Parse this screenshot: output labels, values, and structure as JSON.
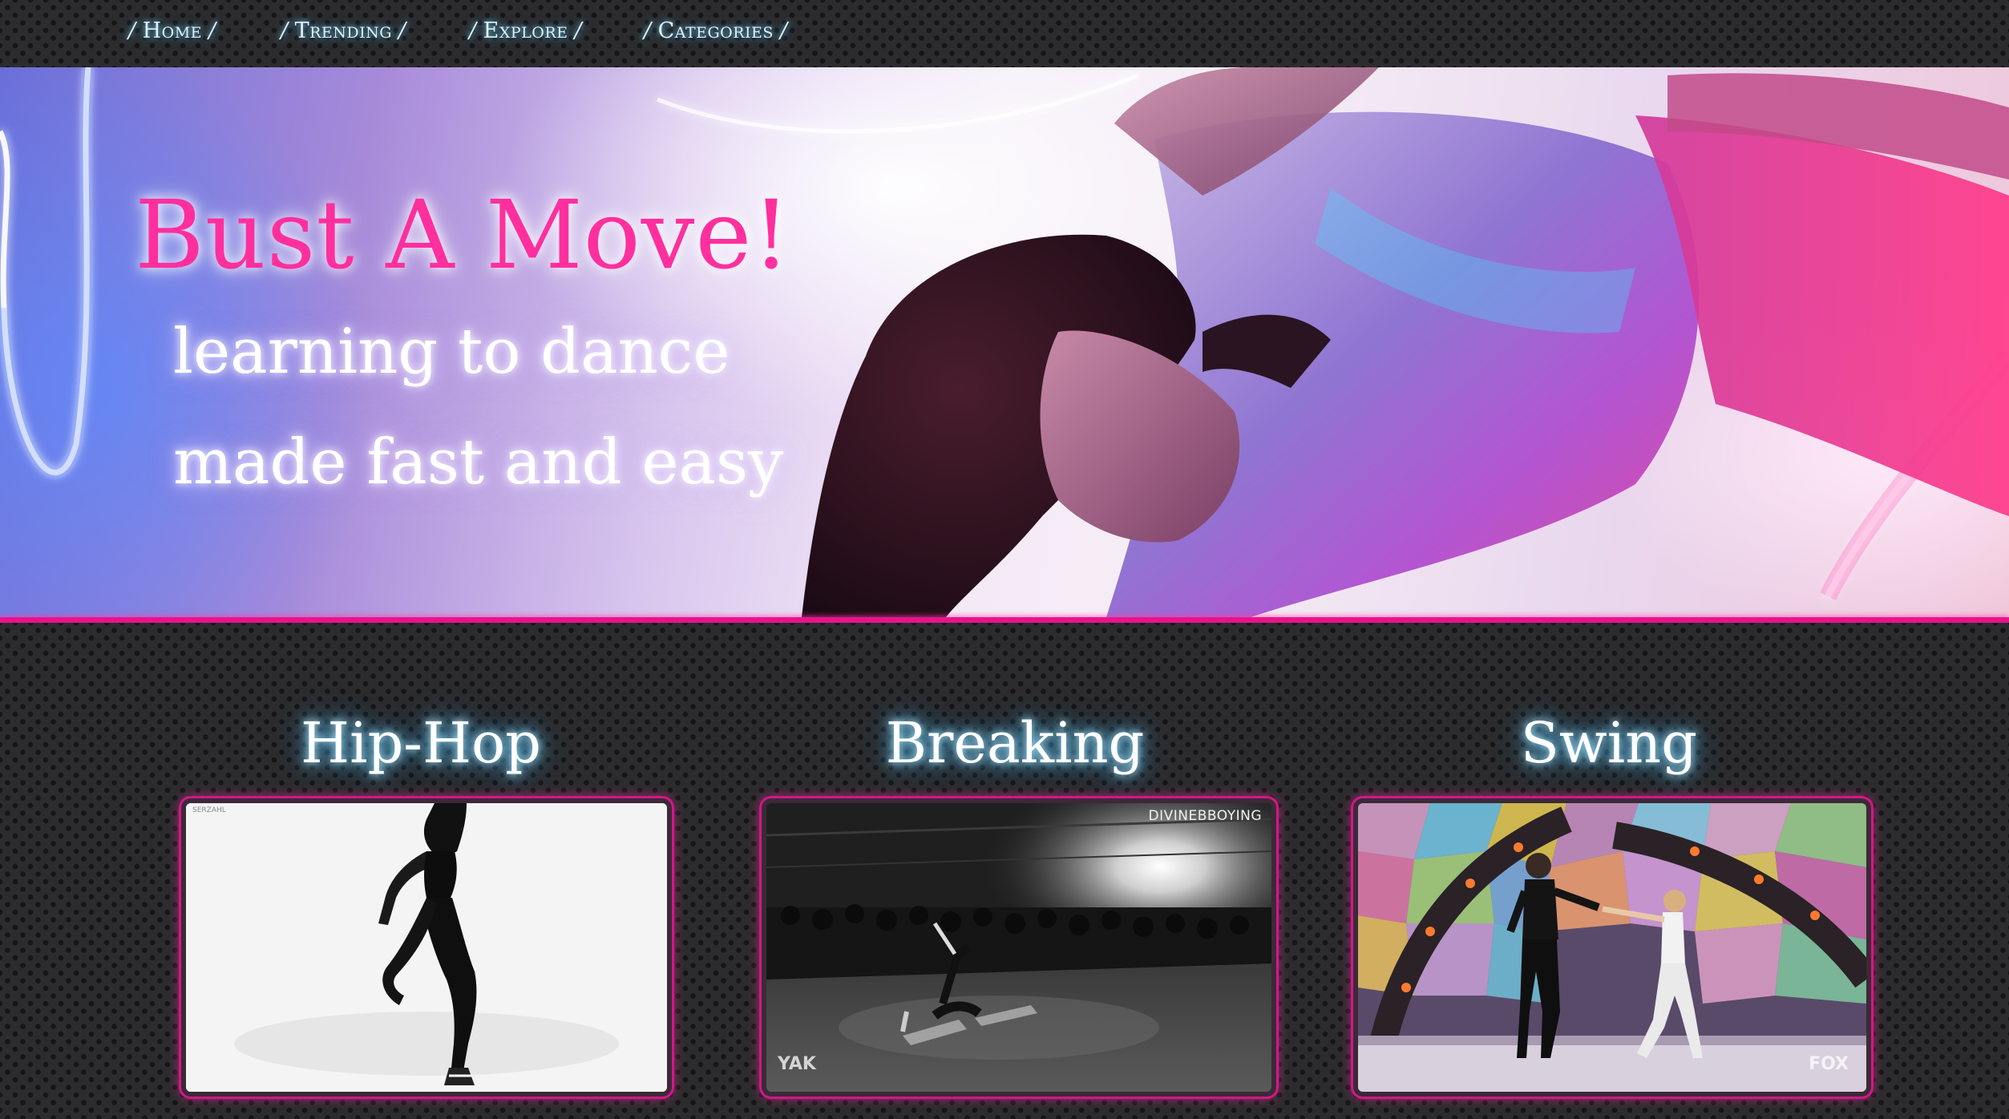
{
  "nav": {
    "items": [
      {
        "label": "Home"
      },
      {
        "label": "Trending"
      },
      {
        "label": "Explore"
      },
      {
        "label": "Categories"
      }
    ],
    "separator": "/"
  },
  "hero": {
    "title": "Bust A Move!",
    "subtitle_line1": "learning to dance",
    "subtitle_line2": "made fast and easy",
    "title_color": "#ff2f9d",
    "rule_color": "#e7148c"
  },
  "categories": [
    {
      "title": "Hip-Hop",
      "thumb_caption": "SERZAHL"
    },
    {
      "title": "Breaking",
      "thumb_caption": "DIVINEBBOYING",
      "thumb_logo": "YAK"
    },
    {
      "title": "Swing",
      "thumb_logo": "FOX"
    }
  ]
}
